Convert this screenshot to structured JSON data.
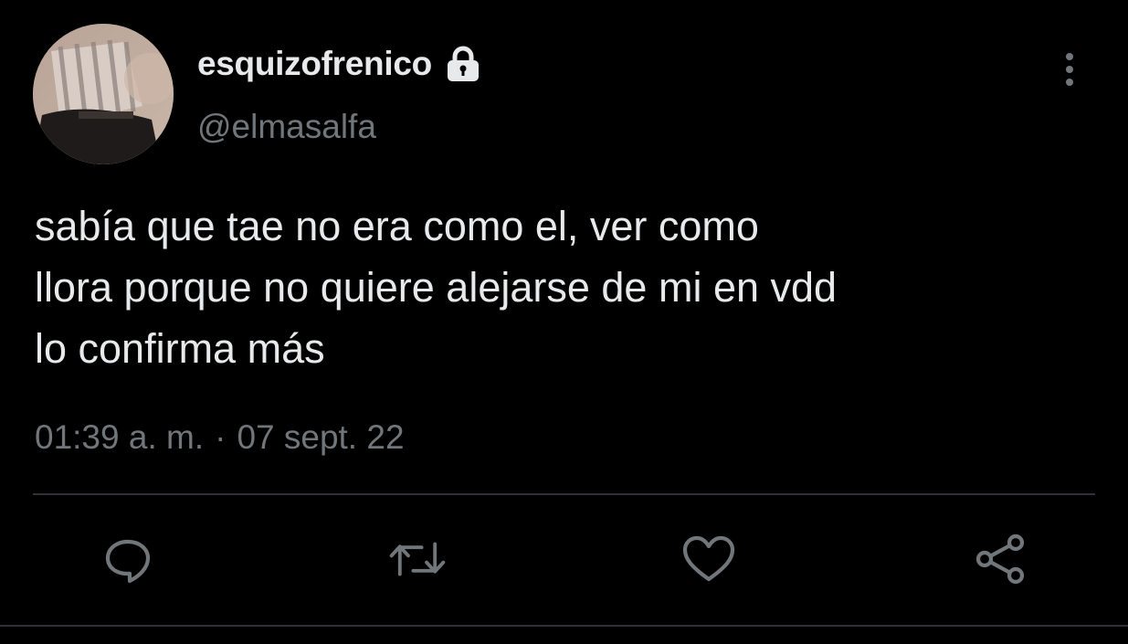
{
  "user": {
    "display_name": "esquizofrenico",
    "handle": "@elmasalfa",
    "protected_icon": "lock-icon",
    "avatar": "profile-photo"
  },
  "menu": {
    "icon": "more-vertical-icon"
  },
  "tweet": {
    "text": "sabía que tae no era como el, ver como\nllora porque no quiere alejarse de mi en vdd\nlo confirma más",
    "time": "01:39 a. m.",
    "separator": "·",
    "date": "07 sept. 22"
  },
  "actions": [
    {
      "name": "reply",
      "icon": "reply-icon"
    },
    {
      "name": "retweet",
      "icon": "retweet-icon"
    },
    {
      "name": "like",
      "icon": "heart-icon"
    },
    {
      "name": "share",
      "icon": "share-icon"
    }
  ],
  "colors": {
    "background": "#000000",
    "primary_text": "#e7e9ea",
    "secondary_text": "#71767b",
    "divider": "#2f3336"
  }
}
